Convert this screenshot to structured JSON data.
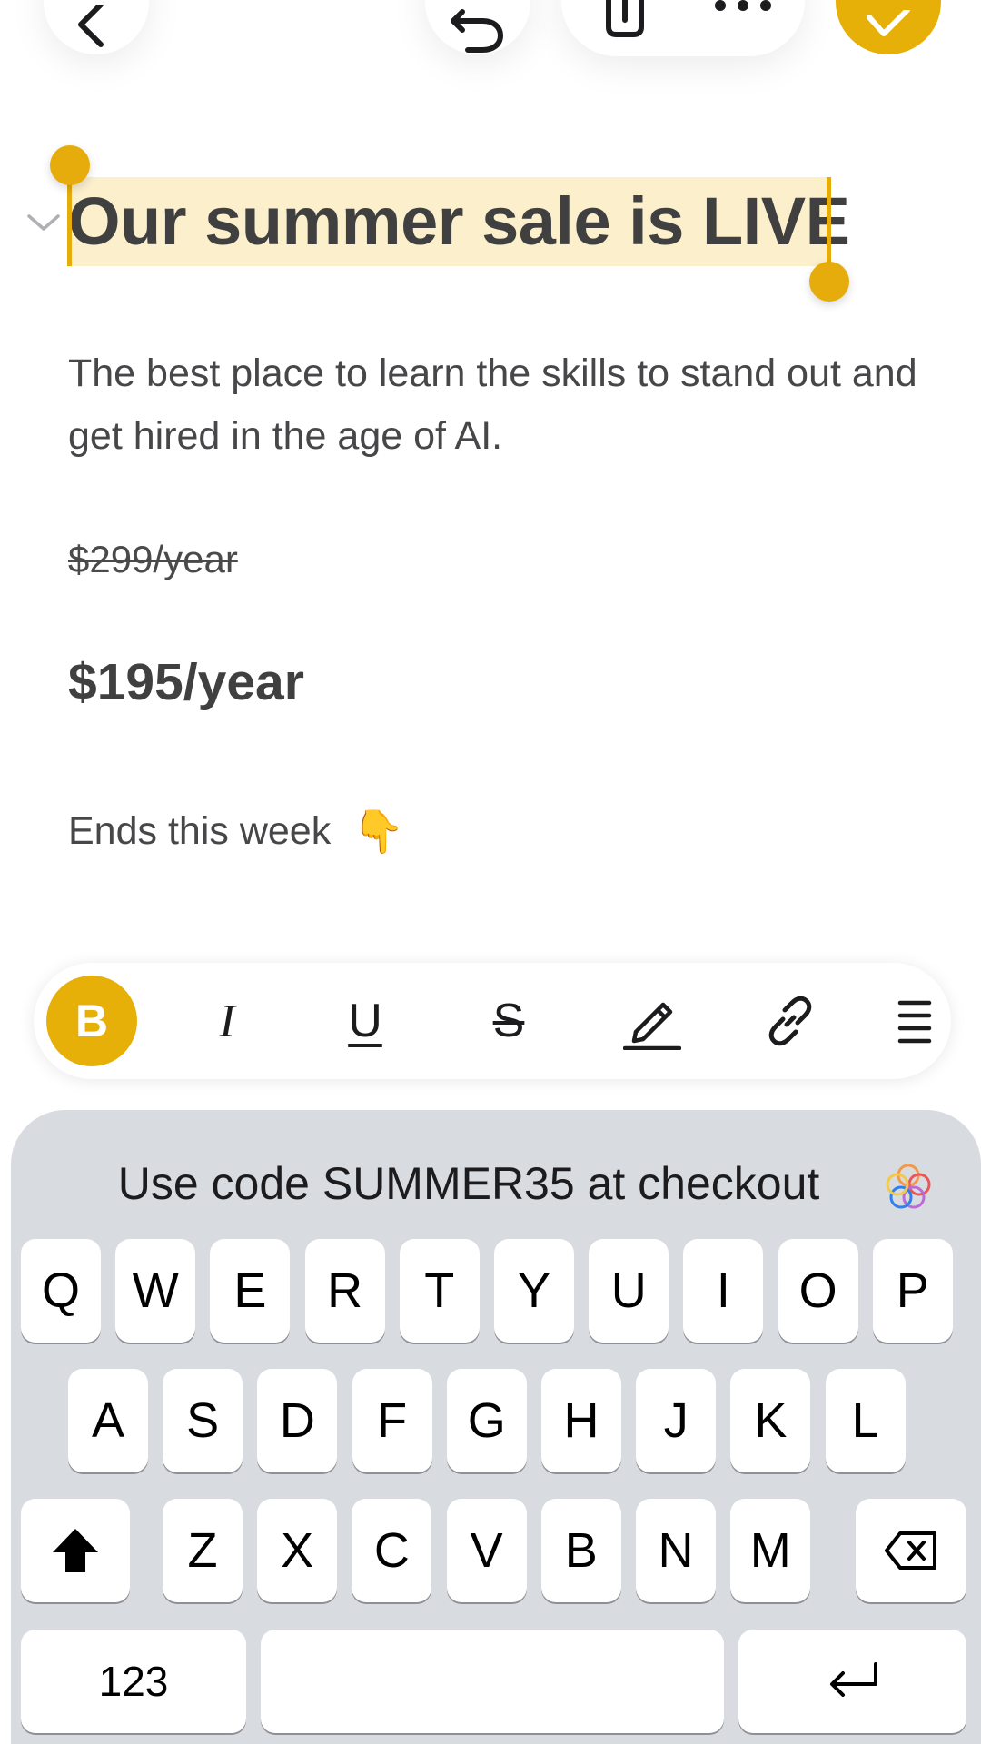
{
  "document": {
    "title": "Our summer sale is LIVE",
    "body": "The best place to learn the skills to stand out and get hired in the age of AI.",
    "old_price": "$299/year",
    "new_price": "$195/year",
    "ends_text": "Ends this week",
    "ends_emoji": "👇"
  },
  "format_toolbar": {
    "bold": "B",
    "italic": "I",
    "underline": "U",
    "strike": "S"
  },
  "keyboard": {
    "suggestion": "Use code SUMMER35 at checkout",
    "row1": [
      "Q",
      "W",
      "E",
      "R",
      "T",
      "Y",
      "U",
      "I",
      "O",
      "P"
    ],
    "row2": [
      "A",
      "S",
      "D",
      "F",
      "G",
      "H",
      "J",
      "K",
      "L"
    ],
    "row3": [
      "Z",
      "X",
      "C",
      "V",
      "B",
      "N",
      "M"
    ],
    "numbers_key": "123"
  },
  "colors": {
    "accent": "#e6b009",
    "highlight": "#fbefcc",
    "keyboard_bg": "#d8dbe0"
  }
}
